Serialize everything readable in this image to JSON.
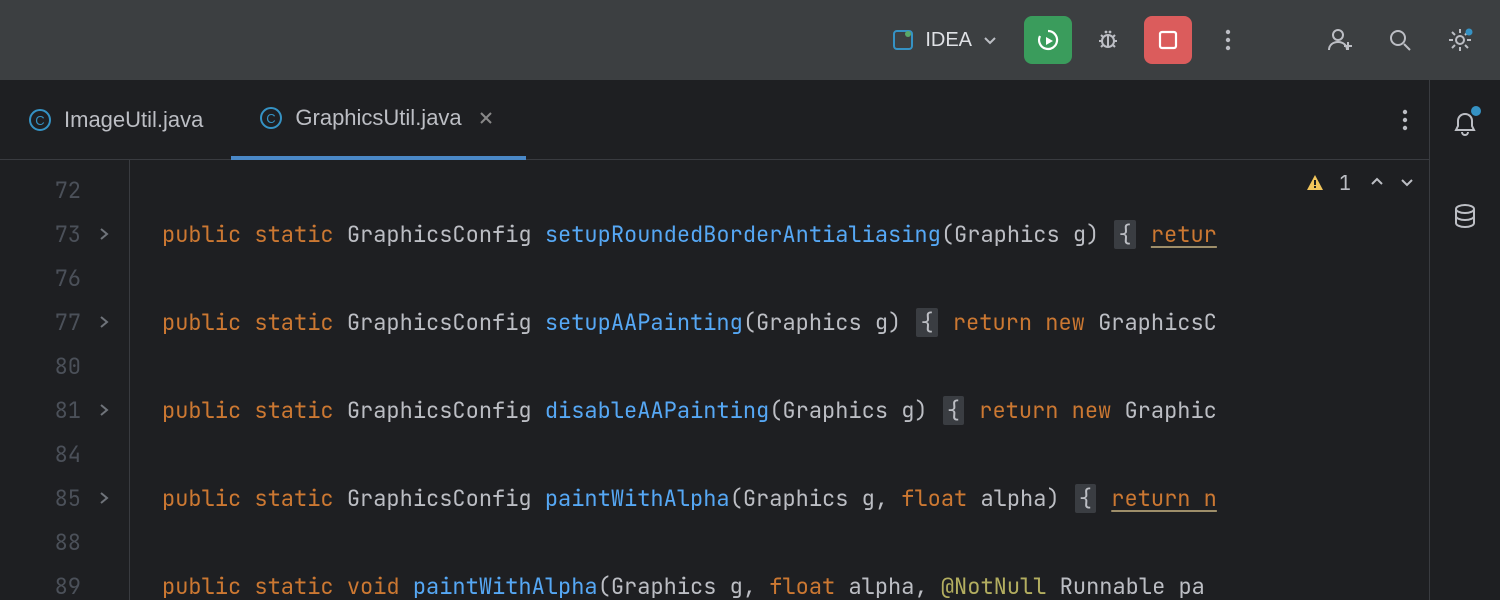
{
  "titlebar": {
    "run_config_label": "IDEA"
  },
  "tabs": [
    {
      "label": "ImageUtil.java",
      "active": false
    },
    {
      "label": "GraphicsUtil.java",
      "active": true
    }
  ],
  "problems": {
    "count": "1"
  },
  "code": {
    "lines": [
      {
        "n": "72",
        "fold": false,
        "tokens": []
      },
      {
        "n": "73",
        "fold": true,
        "tokens": [
          {
            "t": "public ",
            "c": "kw"
          },
          {
            "t": "static ",
            "c": "kw"
          },
          {
            "t": "GraphicsConfig ",
            "c": "type"
          },
          {
            "t": "setupRoundedBorderAntialiasing",
            "c": "method"
          },
          {
            "t": "(Graphics g) ",
            "c": "type"
          },
          {
            "t": "{",
            "c": "brace-hl"
          },
          {
            "t": " ",
            "c": ""
          },
          {
            "t": "retur",
            "c": "kw uline"
          }
        ]
      },
      {
        "n": "76",
        "fold": false,
        "tokens": []
      },
      {
        "n": "77",
        "fold": true,
        "tokens": [
          {
            "t": "public ",
            "c": "kw"
          },
          {
            "t": "static ",
            "c": "kw"
          },
          {
            "t": "GraphicsConfig ",
            "c": "type"
          },
          {
            "t": "setupAAPainting",
            "c": "method"
          },
          {
            "t": "(Graphics g) ",
            "c": "type"
          },
          {
            "t": "{",
            "c": "brace-hl"
          },
          {
            "t": " ",
            "c": ""
          },
          {
            "t": "return ",
            "c": "kw"
          },
          {
            "t": "new ",
            "c": "kw"
          },
          {
            "t": "GraphicsC",
            "c": "type"
          }
        ]
      },
      {
        "n": "80",
        "fold": false,
        "tokens": []
      },
      {
        "n": "81",
        "fold": true,
        "tokens": [
          {
            "t": "public ",
            "c": "kw"
          },
          {
            "t": "static ",
            "c": "kw"
          },
          {
            "t": "GraphicsConfig ",
            "c": "type"
          },
          {
            "t": "disableAAPainting",
            "c": "method"
          },
          {
            "t": "(Graphics g) ",
            "c": "type"
          },
          {
            "t": "{",
            "c": "brace-hl"
          },
          {
            "t": " ",
            "c": ""
          },
          {
            "t": "return ",
            "c": "kw"
          },
          {
            "t": "new ",
            "c": "kw"
          },
          {
            "t": "Graphic",
            "c": "type"
          }
        ]
      },
      {
        "n": "84",
        "fold": false,
        "tokens": []
      },
      {
        "n": "85",
        "fold": true,
        "tokens": [
          {
            "t": "public ",
            "c": "kw"
          },
          {
            "t": "static ",
            "c": "kw"
          },
          {
            "t": "GraphicsConfig ",
            "c": "type"
          },
          {
            "t": "paintWithAlpha",
            "c": "method"
          },
          {
            "t": "(Graphics g, ",
            "c": "type"
          },
          {
            "t": "float ",
            "c": "param-kw"
          },
          {
            "t": "alpha) ",
            "c": "type"
          },
          {
            "t": "{",
            "c": "brace-hl"
          },
          {
            "t": " ",
            "c": ""
          },
          {
            "t": "return n",
            "c": "kw uline"
          }
        ]
      },
      {
        "n": "88",
        "fold": false,
        "tokens": []
      },
      {
        "n": "89",
        "fold": false,
        "tokens": [
          {
            "t": "public ",
            "c": "kw"
          },
          {
            "t": "static ",
            "c": "kw"
          },
          {
            "t": "void ",
            "c": "kw"
          },
          {
            "t": "paintWithAlpha",
            "c": "method"
          },
          {
            "t": "(Graphics g, ",
            "c": "type"
          },
          {
            "t": "float ",
            "c": "param-kw"
          },
          {
            "t": "alpha, ",
            "c": "type"
          },
          {
            "t": "@NotNull ",
            "c": "ann"
          },
          {
            "t": "Runnable pa",
            "c": "type"
          }
        ]
      }
    ]
  }
}
